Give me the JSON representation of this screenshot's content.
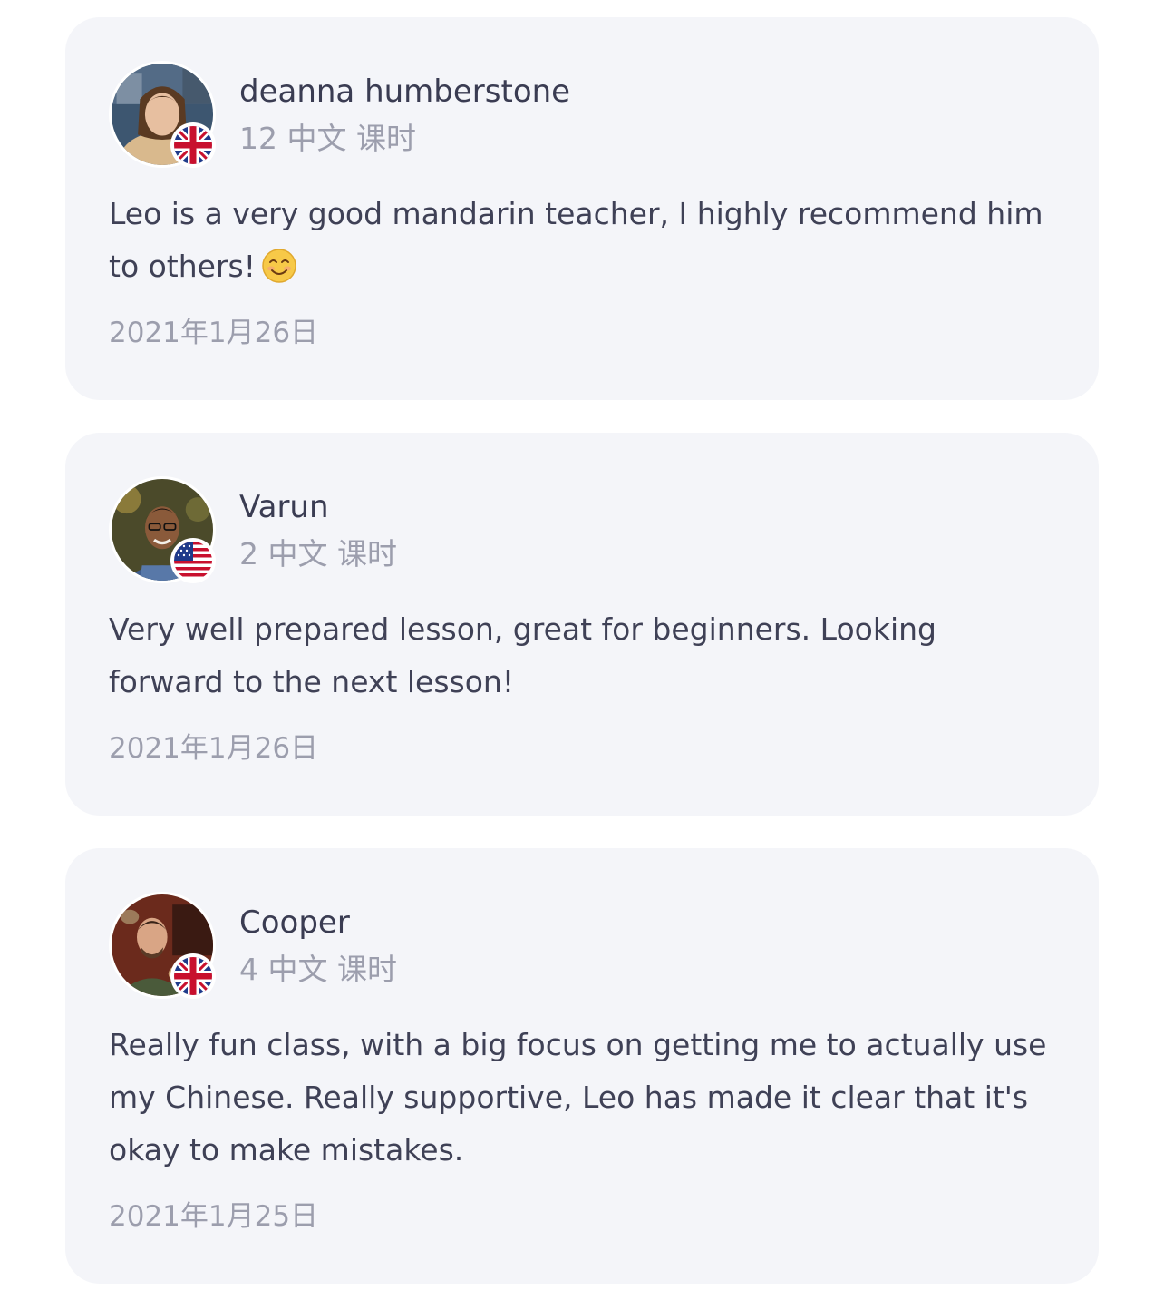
{
  "reviews": [
    {
      "name": "deanna humberstone",
      "lessons": "12 中文 课时",
      "flag": "uk-flag-icon",
      "text": "Leo is a very good mandarin teacher, I highly recommend him to others!",
      "emoji": "smiling-face-emoji-icon",
      "date": "2021年1月26日"
    },
    {
      "name": "Varun",
      "lessons": "2 中文 课时",
      "flag": "us-flag-icon",
      "text": "Very well prepared lesson, great for beginners. Looking forward to the next lesson!",
      "date": "2021年1月26日"
    },
    {
      "name": "Cooper",
      "lessons": "4 中文 课时",
      "flag": "uk-flag-icon",
      "text": "Really fun class, with a big focus on getting me to actually use my Chinese. Really supportive, Leo has made it clear that it's okay to make mistakes.",
      "date": "2021年1月25日"
    }
  ],
  "colors": {
    "card_background": "#f4f5f9",
    "name_text": "#3a3c52",
    "body_text": "#3f4156",
    "muted_text": "#9c9ead"
  }
}
